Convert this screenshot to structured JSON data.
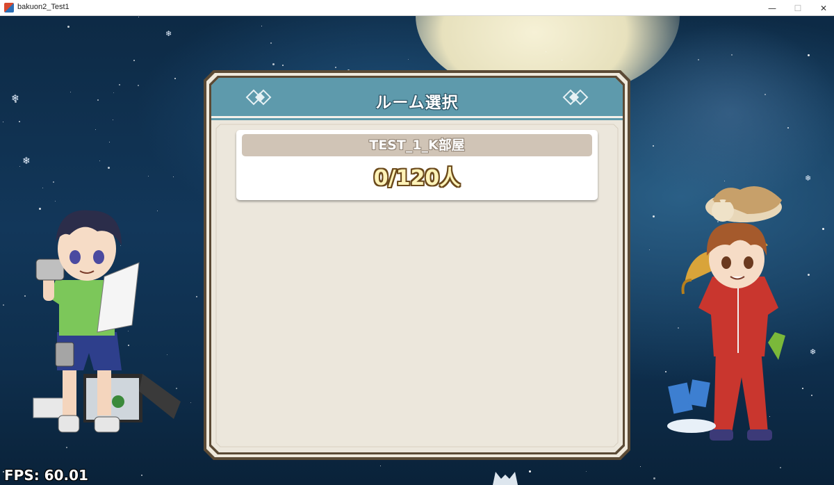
{
  "window": {
    "title": "bakuon2_Test1",
    "minimize_glyph": "—",
    "maximize_glyph": "☐",
    "close_glyph": "✕"
  },
  "dialog": {
    "title": "ルーム選択",
    "rooms": [
      {
        "name": "TEST_1_K部屋",
        "count": "0/120人"
      }
    ]
  },
  "hud": {
    "fps": "FPS: 60.01"
  },
  "colors": {
    "header_teal": "#5e9aac",
    "panel_cream": "#ece7dc",
    "frame_brown": "#5b4a35",
    "room_bar": "#d0c4b6",
    "count_text": "#fff3b8"
  },
  "icons": [
    "app-icon",
    "diamond-ornament-icon",
    "snowflake-icon"
  ]
}
